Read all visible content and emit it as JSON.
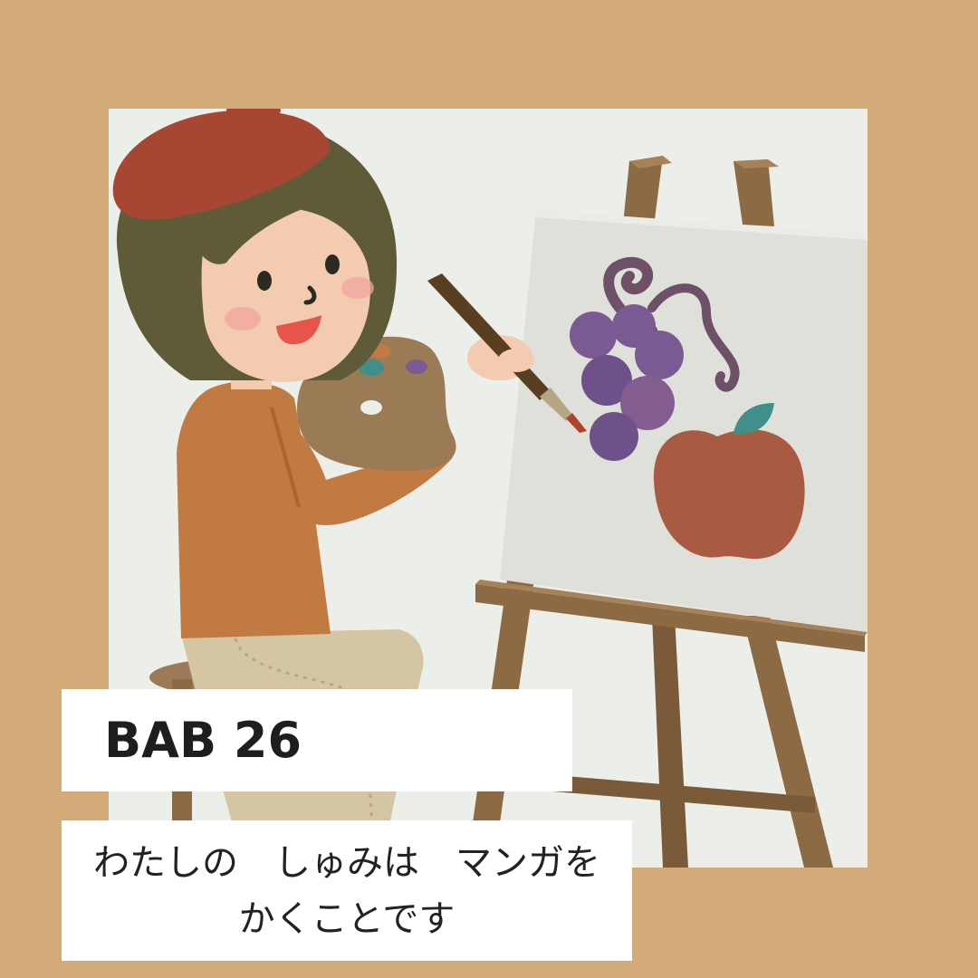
{
  "title": "BAB 26",
  "subtitle": {
    "line1": "わたしの　しゅみは　マンガを",
    "line2": "かくことです"
  },
  "colors": {
    "frame": "#d2ab78",
    "panel": "#eceeea",
    "beret": "#a84634",
    "hair": "#5f5a38",
    "sweater": "#c07a42",
    "easel": "#8c6a44",
    "grapes": "#7a5a92",
    "apple": "#a95a42"
  },
  "icons": [
    "painter-illustration",
    "easel-icon",
    "palette-icon",
    "paintbrush-icon",
    "grapes-icon",
    "apple-icon"
  ]
}
